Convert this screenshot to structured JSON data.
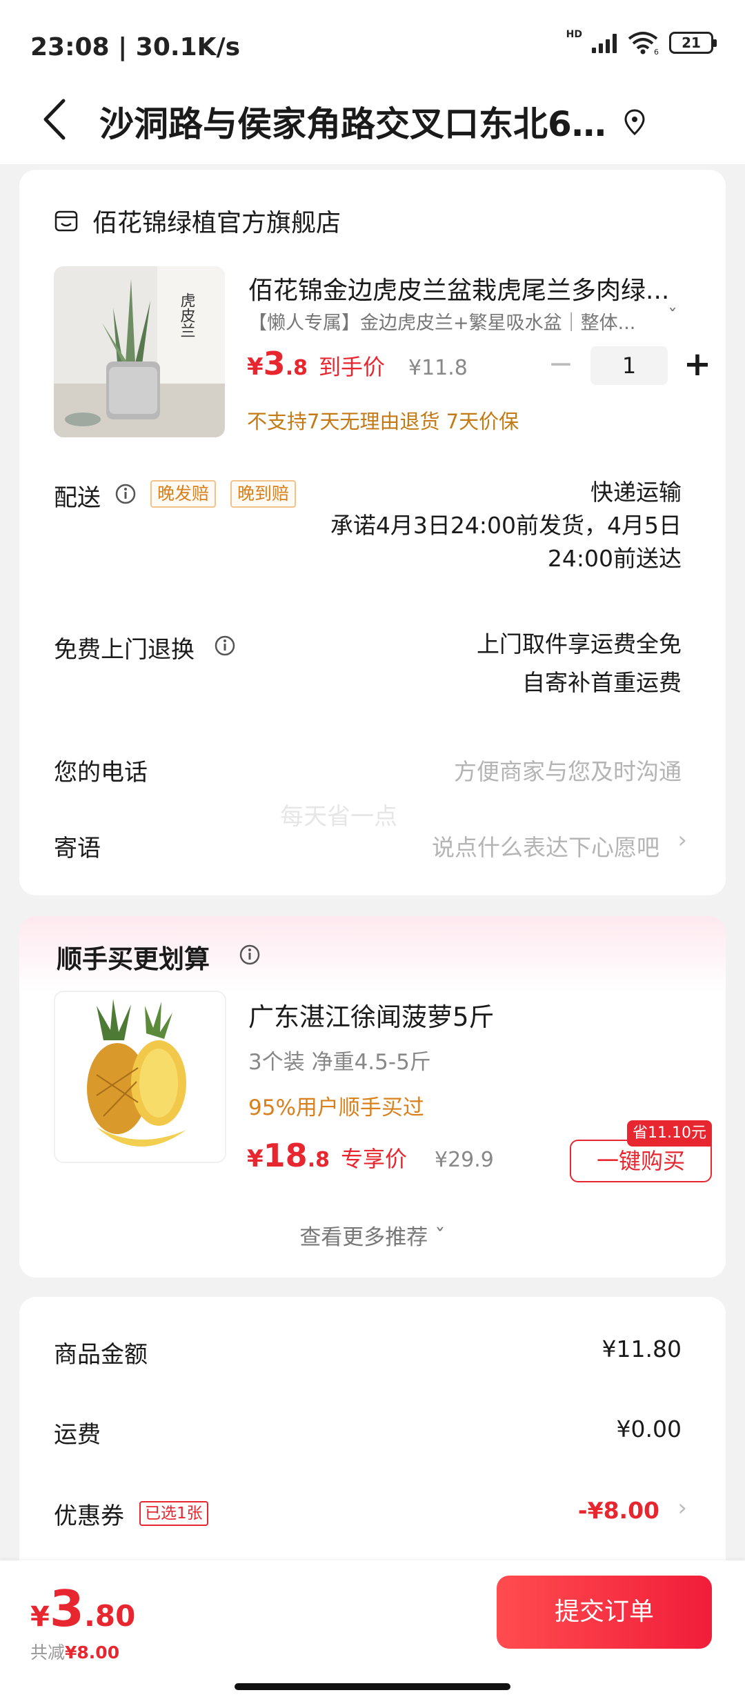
{
  "status_bar": {
    "time": "23:08 | 30.1K/s",
    "network": "HD",
    "wifi_badge": "6",
    "battery": "21"
  },
  "header": {
    "address": "沙洞路与侯家角路交叉口东北6..."
  },
  "store": {
    "name": "佰花锦绿植官方旗舰店"
  },
  "product": {
    "image_text": "虎皮兰",
    "title": "佰花锦金边虎皮兰盆栽虎尾兰多肉绿...",
    "spec": "【懒人专属】金边虎皮兰+繁星吸水盆｜整体...",
    "price_currency": "¥",
    "price_int": "3",
    "price_dec": ".8",
    "price_tag": "到手价",
    "original_price": "¥11.8",
    "quantity": "1",
    "minus": "−",
    "plus": "+",
    "policy": "不支持7天无理由退货  7天价保"
  },
  "delivery": {
    "label": "配送",
    "tags": [
      "晚发赔",
      "晚到赔"
    ],
    "method": "快递运输",
    "promise_line1": "承诺4月3日24:00前发货，4月5日",
    "promise_line2": "24:00前送达"
  },
  "free_return": {
    "label": "免费上门退换",
    "line1": "上门取件享运费全免",
    "line2": "自寄补首重运费"
  },
  "phone": {
    "label": "您的电话",
    "placeholder": "方便商家与您及时沟通"
  },
  "message": {
    "label": "寄语",
    "placeholder": "说点什么表达下心愿吧",
    "chevron": "›"
  },
  "watermark": "每天省一点",
  "upsell": {
    "title": "顺手买更划算",
    "product_title": "广东湛江徐闻菠萝5斤",
    "spec": "3个装  净重4.5-5斤",
    "bought": "95%用户顺手买过",
    "price_currency": "¥",
    "price_int": "18",
    "price_dec": ".8",
    "price_tag": "专享价",
    "original_price": "¥29.9",
    "save_badge": "省11.10元",
    "buy_button": "一键购买",
    "more": "查看更多推荐 ˇ"
  },
  "summary": {
    "goods_label": "商品金额",
    "goods_value": "¥11.80",
    "shipping_label": "运费",
    "shipping_value": "¥0.00",
    "coupon_label": "优惠券",
    "coupon_badge": "已选1张",
    "coupon_value": "-¥8.00",
    "chevron": "›"
  },
  "bottom": {
    "total_currency": "¥",
    "total_int": "3",
    "total_dec": ".80",
    "saved_prefix": "共减",
    "saved_value": "¥8.00",
    "submit": "提交订单"
  },
  "colors": {
    "accent": "#e8262f",
    "orange": "#d9801c"
  }
}
